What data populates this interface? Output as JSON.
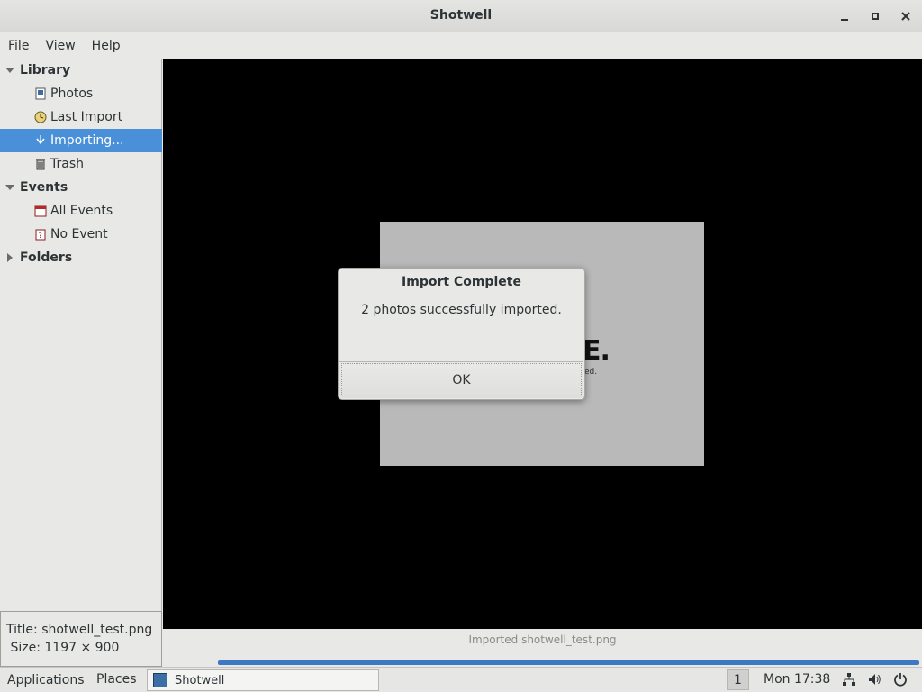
{
  "window": {
    "title": "Shotwell"
  },
  "menubar": {
    "items": [
      "File",
      "View",
      "Help"
    ]
  },
  "sidebar": {
    "library_header": "Library",
    "library_items": [
      {
        "label": "Photos",
        "icon": "photos-icon"
      },
      {
        "label": "Last Import",
        "icon": "last-import-icon"
      },
      {
        "label": "Importing...",
        "icon": "importing-icon",
        "selected": true
      },
      {
        "label": "Trash",
        "icon": "trash-icon"
      }
    ],
    "events_header": "Events",
    "events_items": [
      {
        "label": "All Events",
        "icon": "all-events-icon"
      },
      {
        "label": "No Event",
        "icon": "no-event-icon"
      }
    ],
    "folders_header": "Folders"
  },
  "info": {
    "title_label": "Title:",
    "title_value": "shotwell_test.png",
    "size_label": "Size:",
    "size_value": "1197 × 900"
  },
  "viewer": {
    "photo_mark": "E.",
    "photo_mark_sub": "ed."
  },
  "statusbar": {
    "message": "Imported shotwell_test.png",
    "progress_fraction": 1.0
  },
  "dialog": {
    "title": "Import Complete",
    "message": "2 photos successfully imported.",
    "ok_label": "OK"
  },
  "panel": {
    "applications": "Applications",
    "places": "Places",
    "task": "Shotwell",
    "workspace": "1",
    "clock": "Mon 17:38"
  },
  "colors": {
    "selection": "#4a90d9",
    "progress": "#3c79c4"
  }
}
